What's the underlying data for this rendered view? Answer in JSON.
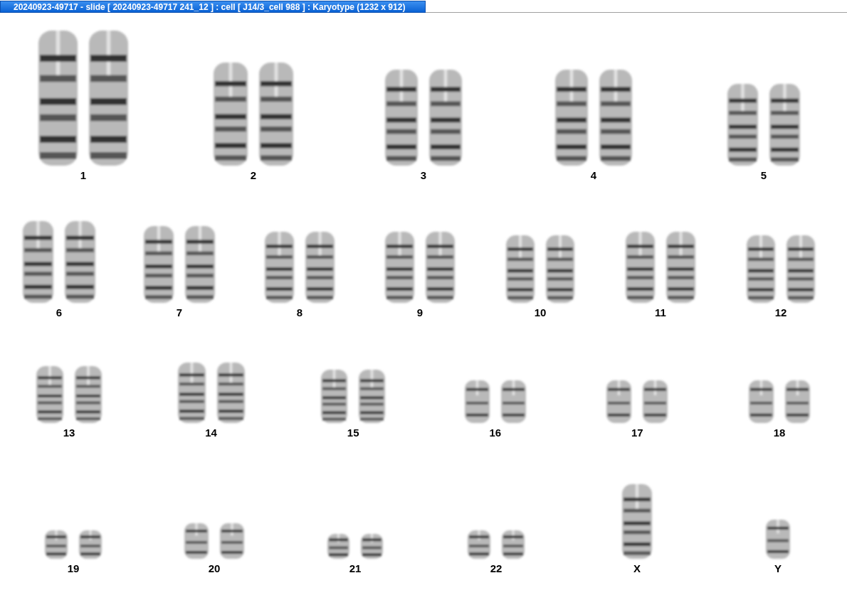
{
  "window": {
    "title": "20240923-49717 - slide [ 20240923-49717 241_12 ] : cell [ J14/3_cell 988 ] : Karyotype  (1232 x 912)"
  },
  "karyotype_rows": [
    {
      "chromosomes": [
        {
          "label": "1",
          "kind": "pair"
        },
        {
          "label": "2",
          "kind": "pair"
        },
        {
          "label": "3",
          "kind": "pair"
        },
        {
          "label": "4",
          "kind": "pair"
        },
        {
          "label": "5",
          "kind": "pair"
        }
      ]
    },
    {
      "chromosomes": [
        {
          "label": "6",
          "kind": "pair"
        },
        {
          "label": "7",
          "kind": "pair"
        },
        {
          "label": "8",
          "kind": "pair"
        },
        {
          "label": "9",
          "kind": "pair"
        },
        {
          "label": "10",
          "kind": "pair"
        },
        {
          "label": "11",
          "kind": "pair"
        },
        {
          "label": "12",
          "kind": "pair"
        }
      ]
    },
    {
      "chromosomes": [
        {
          "label": "13",
          "kind": "pair"
        },
        {
          "label": "14",
          "kind": "pair"
        },
        {
          "label": "15",
          "kind": "pair"
        },
        {
          "label": "16",
          "kind": "pair"
        },
        {
          "label": "17",
          "kind": "pair"
        },
        {
          "label": "18",
          "kind": "pair"
        }
      ]
    },
    {
      "chromosomes": [
        {
          "label": "19",
          "kind": "pair"
        },
        {
          "label": "20",
          "kind": "pair"
        },
        {
          "label": "21",
          "kind": "pair"
        },
        {
          "label": "22",
          "kind": "pair"
        },
        {
          "label": "X",
          "kind": "single"
        },
        {
          "label": "Y",
          "kind": "single"
        }
      ]
    }
  ]
}
